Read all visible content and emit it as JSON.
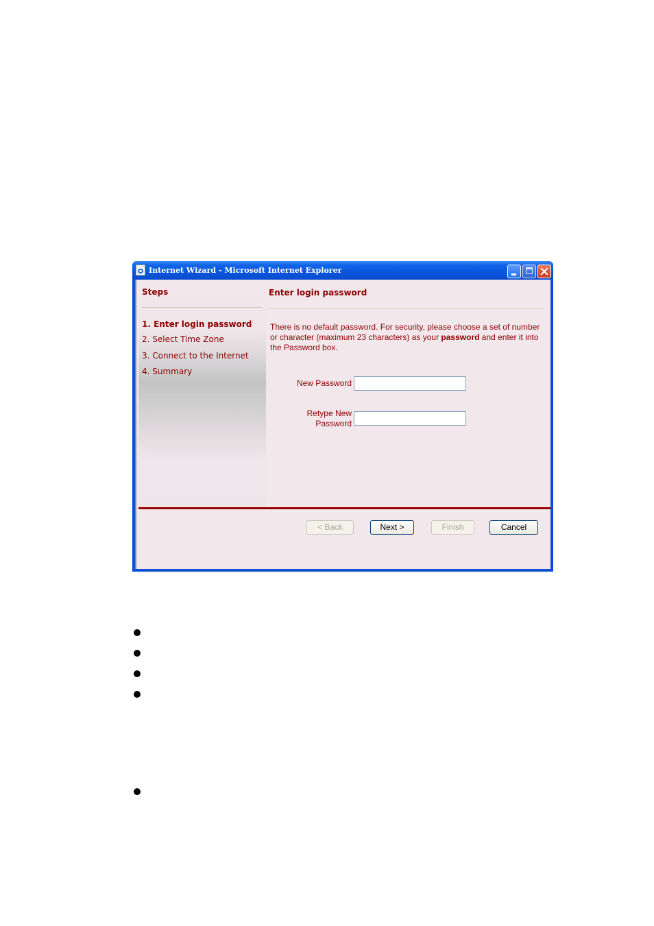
{
  "window": {
    "title": "Internet Wizard - Microsoft Internet Explorer",
    "controls": [
      "minimize",
      "maximize",
      "close"
    ]
  },
  "sidebar": {
    "heading": "Steps",
    "steps": [
      {
        "label": "1. Enter login password",
        "active": true
      },
      {
        "label": "2. Select Time Zone",
        "active": false
      },
      {
        "label": "3. Connect to the Internet",
        "active": false
      },
      {
        "label": "4. Summary",
        "active": false
      }
    ]
  },
  "content": {
    "heading": "Enter login password",
    "description_before": "There is no default password. For security, please choose a set of number or character (maximum 23 characters) as your ",
    "description_bold": "password",
    "description_after": " and enter it into the Password box.",
    "fields": [
      {
        "label": "New Password",
        "value": ""
      },
      {
        "label_line1": "Retype New",
        "label_line2": "Password",
        "value": ""
      }
    ]
  },
  "buttons": {
    "back": {
      "label": "< Back",
      "enabled": false
    },
    "next": {
      "label": "Next >",
      "enabled": true
    },
    "finish": {
      "label": "Finish",
      "enabled": false
    },
    "cancel": {
      "label": "Cancel",
      "enabled": true
    }
  },
  "colors": {
    "accent": "#8b0000",
    "rule": "#990000",
    "titlebar": "#0a55dc",
    "background": "#f2e8ec"
  },
  "document": {
    "bullet_count_group1": 4,
    "bullet_count_group2": 1
  }
}
